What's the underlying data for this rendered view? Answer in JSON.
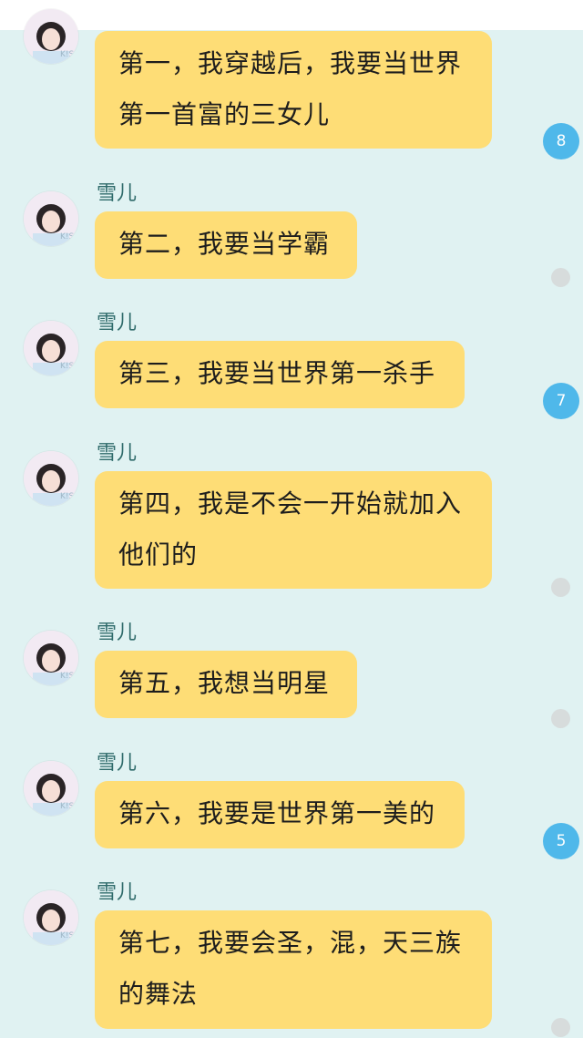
{
  "messages": [
    {
      "sender": "",
      "text": "第一，我穿越后，我要当世界第一首富的三女儿",
      "indicator": "badge",
      "badge_count": "8"
    },
    {
      "sender": "雪儿",
      "text": "第二，我要当学霸",
      "indicator": "read-dot",
      "badge_count": ""
    },
    {
      "sender": "雪儿",
      "text": "第三，我要当世界第一杀手",
      "indicator": "badge",
      "badge_count": "7"
    },
    {
      "sender": "雪儿",
      "text": "第四，我是不会一开始就加入他们的",
      "indicator": "read-dot",
      "badge_count": ""
    },
    {
      "sender": "雪儿",
      "text": "第五，我想当明星",
      "indicator": "read-dot",
      "badge_count": ""
    },
    {
      "sender": "雪儿",
      "text": "第六，我要是世界第一美的",
      "indicator": "badge",
      "badge_count": "5"
    },
    {
      "sender": "雪儿",
      "text": "第七，我要会圣，混，天三族的舞法",
      "indicator": "read-dot",
      "badge_count": ""
    }
  ],
  "colors": {
    "background": "#e0f2f2",
    "bubble": "#fedd76",
    "badge": "#4fb8ea",
    "read_dot": "#d7dcdc"
  }
}
